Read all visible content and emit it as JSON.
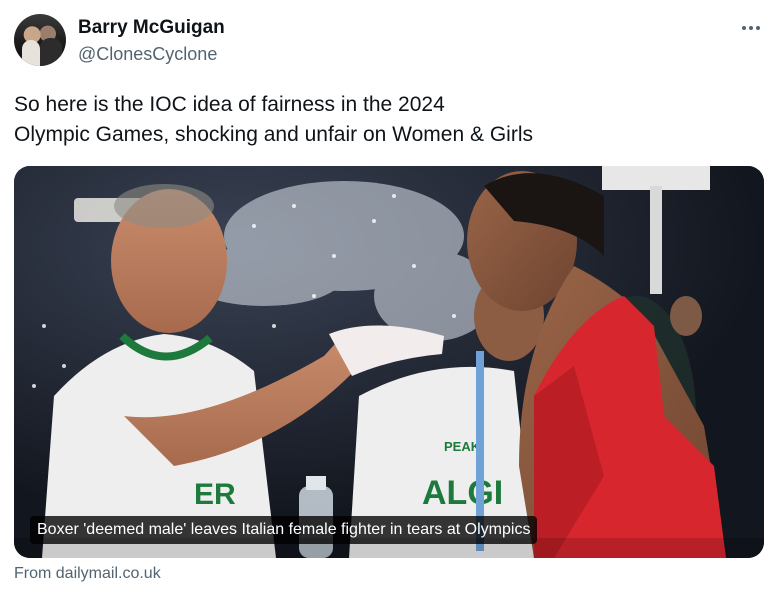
{
  "author": {
    "display_name": "Barry McGuigan",
    "handle": "@ClonesCyclone",
    "avatar_icon": "profile-photo"
  },
  "more_icon": "ellipsis-icon",
  "tweet": {
    "lines": [
      "So here is the IOC idea of fairness in the 2024",
      "Olympic Games, shocking and unfair on Women & Girls"
    ]
  },
  "card": {
    "caption": "Boxer 'deemed male' leaves Italian female fighter in tears at Olympics",
    "shirt_text_left": "ER",
    "shirt_text_right": "ALGI",
    "brand_text": "PEAK",
    "source": "From dailymail.co.uk"
  },
  "colors": {
    "text_primary": "#0f1419",
    "text_secondary": "#536471",
    "jersey_green": "#1d7a3c",
    "jersey_red": "#d8262e"
  }
}
